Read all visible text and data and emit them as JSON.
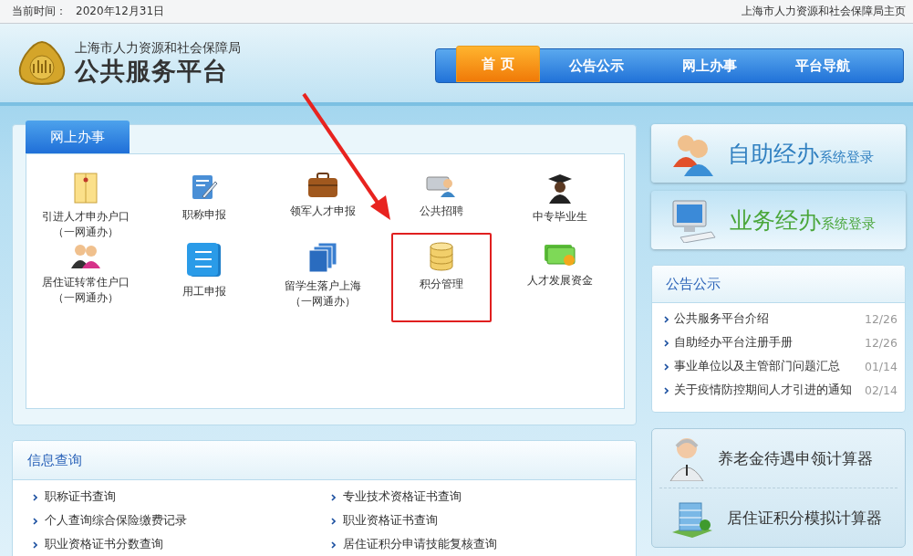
{
  "top_bar": {
    "date_label": "当前时间：",
    "date": "2020年12月31日",
    "home_link": "上海市人力资源和社会保障局主页"
  },
  "header": {
    "org": "上海市人力资源和社会保障局",
    "title": "公共服务平台"
  },
  "nav": [
    {
      "label": "首 页",
      "selected": true
    },
    {
      "label": "公告公示",
      "selected": false
    },
    {
      "label": "网上办事",
      "selected": false
    },
    {
      "label": "平台导航",
      "selected": false
    }
  ],
  "online_services": {
    "tab": "网上办事",
    "items": [
      {
        "label": [
          "引进人才申办户口",
          "（一网通办）"
        ],
        "highlighted": false
      },
      {
        "label": [
          "职称申报"
        ],
        "highlighted": false
      },
      {
        "label": [
          "领军人才申报"
        ],
        "highlighted": false
      },
      {
        "label": [
          "公共招聘"
        ],
        "highlighted": false
      },
      {
        "label": [
          "中专毕业生"
        ],
        "highlighted": false
      },
      {
        "label": [
          "居住证转常住户口",
          "（一网通办）"
        ],
        "highlighted": false
      },
      {
        "label": [
          "用工申报"
        ],
        "highlighted": false
      },
      {
        "label": [
          "留学生落户上海",
          "（一网通办）"
        ],
        "highlighted": false
      },
      {
        "label": [
          "积分管理"
        ],
        "highlighted": true
      },
      {
        "label": [
          "人才发展资金"
        ],
        "highlighted": false
      }
    ]
  },
  "info_query": {
    "title": "信息查询",
    "items": [
      "职称证书查询",
      "专业技术资格证书查询",
      "个人查询综合保险缴费记录",
      "职业资格证书查询",
      "职业资格证书分数查询",
      "居住证积分申请技能复核查询"
    ]
  },
  "login_banners": [
    {
      "big": "自助经办",
      "small": "系统登录",
      "kind": "people"
    },
    {
      "big": "业务经办",
      "small": "系统登录",
      "kind": "computer"
    }
  ],
  "notices": {
    "title": "公告公示",
    "items": [
      {
        "text": "公共服务平台介绍",
        "date": "12/26"
      },
      {
        "text": "自助经办平台注册手册",
        "date": "12/26"
      },
      {
        "text": "事业单位以及主管部门问题汇总",
        "date": "01/14"
      },
      {
        "text": "关于疫情防控期间人才引进的通知",
        "date": "02/14"
      }
    ]
  },
  "calculators": [
    {
      "label": "养老金待遇申领计算器",
      "kind": "elder"
    },
    {
      "label": "居住证积分模拟计算器",
      "kind": "building"
    }
  ]
}
